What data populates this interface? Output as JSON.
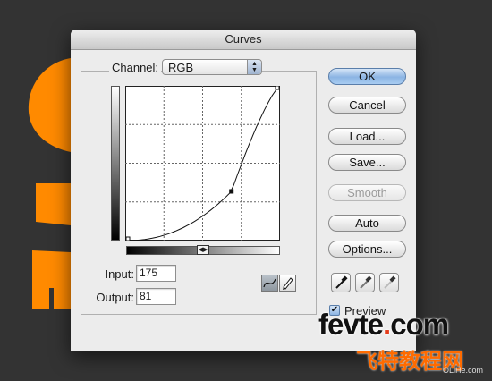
{
  "dialog": {
    "title": "Curves",
    "channel_label": "Channel:",
    "channel_value": "RGB",
    "input_label": "Input:",
    "input_value": "175",
    "output_label": "Output:",
    "output_value": "81",
    "preview_label": "Preview",
    "preview_checked": true
  },
  "buttons": {
    "ok": "OK",
    "cancel": "Cancel",
    "load": "Load...",
    "save": "Save...",
    "smooth": "Smooth",
    "auto": "Auto",
    "options": "Options..."
  },
  "tools": [
    "curve-tool-icon",
    "pencil-tool-icon"
  ],
  "eyedroppers": [
    "black-eyedropper-icon",
    "gray-eyedropper-icon",
    "white-eyedropper-icon"
  ],
  "curve_point": {
    "input": 175,
    "output": 81
  },
  "watermark": {
    "main": "fevte",
    "dot": ".",
    "main_suffix": "com",
    "sub": "飞特教程网",
    "small": "OLiHe.com"
  },
  "colors": {
    "artwork_orange": "#ff8a00",
    "background": "#333333"
  }
}
